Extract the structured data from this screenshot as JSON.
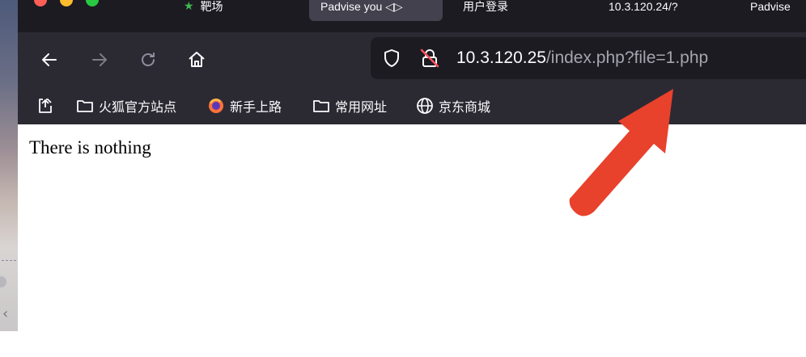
{
  "tabs": [
    {
      "label": "靶场",
      "active": false
    },
    {
      "label": "Padvise you ◁▷",
      "active": true
    },
    {
      "label": "用户登录",
      "active": false
    },
    {
      "label": "10.3.120.24/?",
      "active": false
    },
    {
      "label": "Padvise",
      "active": false
    }
  ],
  "address_bar": {
    "host": "10.3.120.25",
    "path": "/index.php?file=1.php"
  },
  "bookmarks": [
    {
      "label": "火狐官方站点",
      "icon": "folder-icon"
    },
    {
      "label": "新手上路",
      "icon": "firefox-icon"
    },
    {
      "label": "常用网址",
      "icon": "folder-icon"
    },
    {
      "label": "京东商城",
      "icon": "globe-icon"
    }
  ],
  "page": {
    "text": "There is nothing"
  },
  "colors": {
    "toolbar": "#2b2a33",
    "tabbar": "#1c1b22",
    "annotation_arrow": "#e8412c"
  }
}
